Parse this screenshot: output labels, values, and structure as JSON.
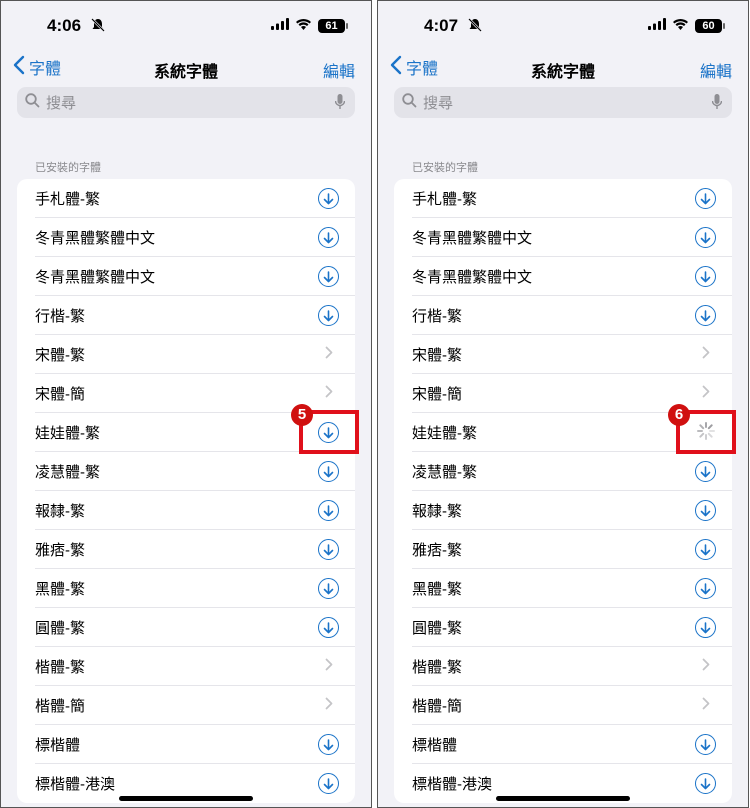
{
  "screens": [
    {
      "time": "4:06",
      "battery": "61",
      "back_label": "字體",
      "title": "系統字體",
      "edit_label": "編輯",
      "search_placeholder": "搜尋",
      "section_header": "已安裝的字體",
      "callout_number": "5",
      "rows": [
        {
          "label": "手札體-繁",
          "control": "download"
        },
        {
          "label": "冬青黑體繁體中文",
          "control": "download"
        },
        {
          "label": "冬青黑體繁體中文",
          "control": "download"
        },
        {
          "label": "行楷-繁",
          "control": "download"
        },
        {
          "label": "宋體-繁",
          "control": "chevron"
        },
        {
          "label": "宋體-簡",
          "control": "chevron"
        },
        {
          "label": "娃娃體-繁",
          "control": "download"
        },
        {
          "label": "凌慧體-繁",
          "control": "download"
        },
        {
          "label": "報隸-繁",
          "control": "download"
        },
        {
          "label": "雅痞-繁",
          "control": "download"
        },
        {
          "label": "黑體-繁",
          "control": "download"
        },
        {
          "label": "圓體-繁",
          "control": "download"
        },
        {
          "label": "楷體-繁",
          "control": "chevron"
        },
        {
          "label": "楷體-簡",
          "control": "chevron"
        },
        {
          "label": "標楷體",
          "control": "download"
        },
        {
          "label": "標楷體-港澳",
          "control": "download"
        }
      ]
    },
    {
      "time": "4:07",
      "battery": "60",
      "back_label": "字體",
      "title": "系統字體",
      "edit_label": "編輯",
      "search_placeholder": "搜尋",
      "section_header": "已安裝的字體",
      "callout_number": "6",
      "rows": [
        {
          "label": "手札體-繁",
          "control": "download"
        },
        {
          "label": "冬青黑體繁體中文",
          "control": "download"
        },
        {
          "label": "冬青黑體繁體中文",
          "control": "download"
        },
        {
          "label": "行楷-繁",
          "control": "download"
        },
        {
          "label": "宋體-繁",
          "control": "chevron"
        },
        {
          "label": "宋體-簡",
          "control": "chevron"
        },
        {
          "label": "娃娃體-繁",
          "control": "spinner"
        },
        {
          "label": "凌慧體-繁",
          "control": "download"
        },
        {
          "label": "報隸-繁",
          "control": "download"
        },
        {
          "label": "雅痞-繁",
          "control": "download"
        },
        {
          "label": "黑體-繁",
          "control": "download"
        },
        {
          "label": "圓體-繁",
          "control": "download"
        },
        {
          "label": "楷體-繁",
          "control": "chevron"
        },
        {
          "label": "楷體-簡",
          "control": "chevron"
        },
        {
          "label": "標楷體",
          "control": "download"
        },
        {
          "label": "標楷體-港澳",
          "control": "download"
        }
      ]
    }
  ],
  "colors": {
    "accent": "#1a73c8",
    "callout": "#e0101b",
    "background": "#f2f2f7"
  }
}
